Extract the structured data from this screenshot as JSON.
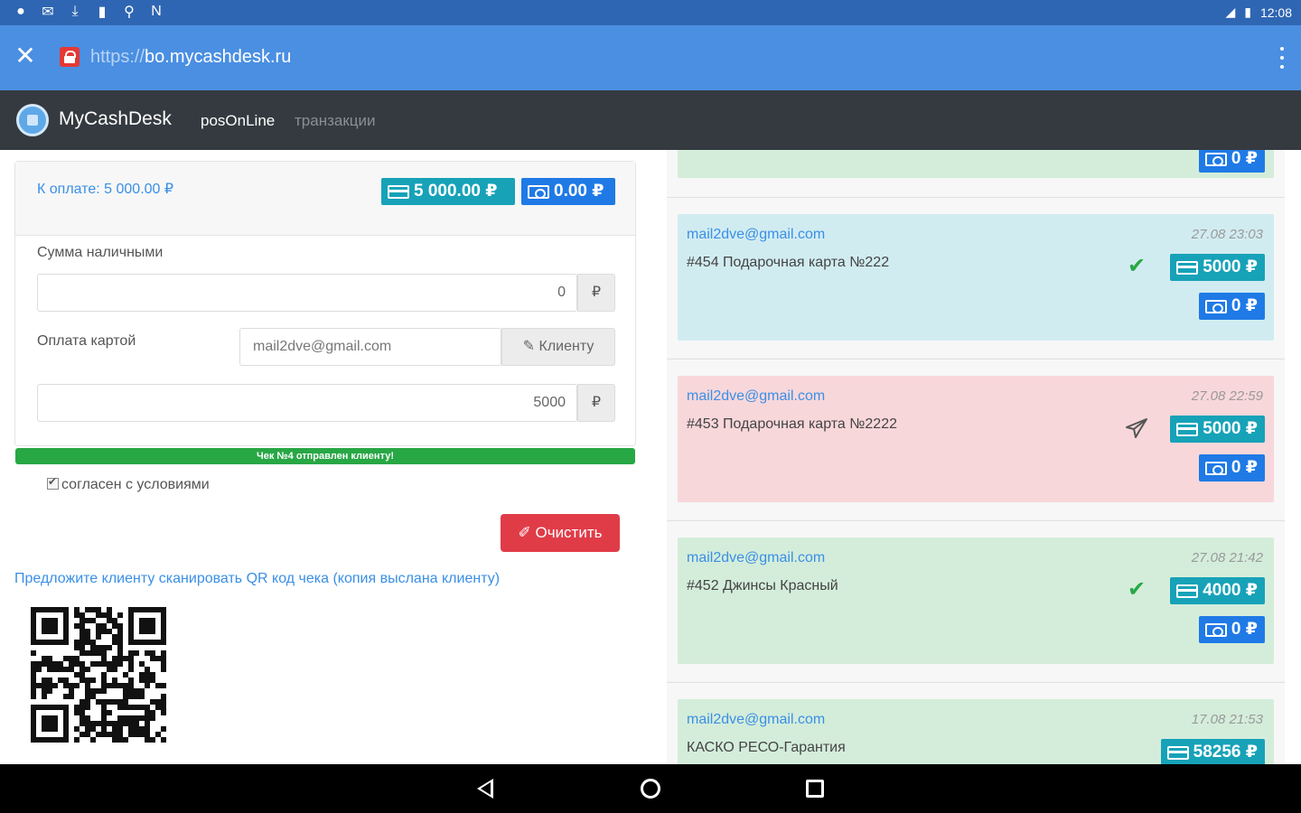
{
  "status_bar": {
    "time": "12:08",
    "icons_left": [
      "location-icon",
      "email-icon",
      "download-icon",
      "sd-card-icon",
      "map-pin-icon",
      "nfc-icon"
    ],
    "icons_right": [
      "signal-icon",
      "battery-icon"
    ]
  },
  "browser": {
    "url_protocol": "https://",
    "url_host": "bo.mycashdesk.ru"
  },
  "app": {
    "brand": "MyCashDesk",
    "nav": {
      "pos": "posOnLine",
      "transactions": "транзакции"
    }
  },
  "payment": {
    "to_pay": "К оплате: 5 000.00 ₽",
    "card_total": "5 000.00 ₽",
    "cash_total": "0.00 ₽",
    "cash_label": "Сумма наличными",
    "cash_value": "0",
    "currency": "₽",
    "card_label": "Оплата картой",
    "email_value": "mail2dve@gmail.com",
    "client_button": "✎ Клиенту",
    "card_value": "5000",
    "progress_text": "Чек №4 отправлен клиенту!",
    "progress_fraction": 1.0,
    "agree_label": "согласен с условиями",
    "clear_button": "✐ Очистить",
    "qr_hint": "Предложите клиенту сканировать QR код чека (копия выслана клиенту)"
  },
  "transactions": [
    {
      "email": "",
      "date": "",
      "desc": "",
      "status": "",
      "card": "",
      "cash": "0 ₽",
      "color": "green"
    },
    {
      "email": "mail2dve@gmail.com",
      "date": "27.08 23:03",
      "desc": "#454 Подарочная карта №222",
      "status": "check-icon",
      "card": "5000 ₽",
      "cash": "0 ₽",
      "color": "blue"
    },
    {
      "email": "mail2dve@gmail.com",
      "date": "27.08 22:59",
      "desc": "#453 Подарочная карта №2222",
      "status": "paper-plane-icon",
      "card": "5000 ₽",
      "cash": "0 ₽",
      "color": "red"
    },
    {
      "email": "mail2dve@gmail.com",
      "date": "27.08 21:42",
      "desc": "#452 Джинсы Красный",
      "status": "check-icon",
      "card": "4000 ₽",
      "cash": "0 ₽",
      "color": "green"
    },
    {
      "email": "mail2dve@gmail.com",
      "date": "17.08 21:53",
      "desc": "КАСКО РЕСО-Гарантия",
      "status": "",
      "card": "58256 ₽",
      "cash": "",
      "color": "green"
    }
  ],
  "colors": {
    "status_bar": "#2f66b3",
    "address_bar": "#4a8fe2",
    "navbar": "#353a40",
    "teal": "#17a2b8",
    "blue": "#1f7ae6",
    "danger": "#e03c48",
    "success": "#28a745",
    "row_green": "#d4edda",
    "row_blue": "#d1ecf1",
    "row_red": "#f8d7da"
  }
}
